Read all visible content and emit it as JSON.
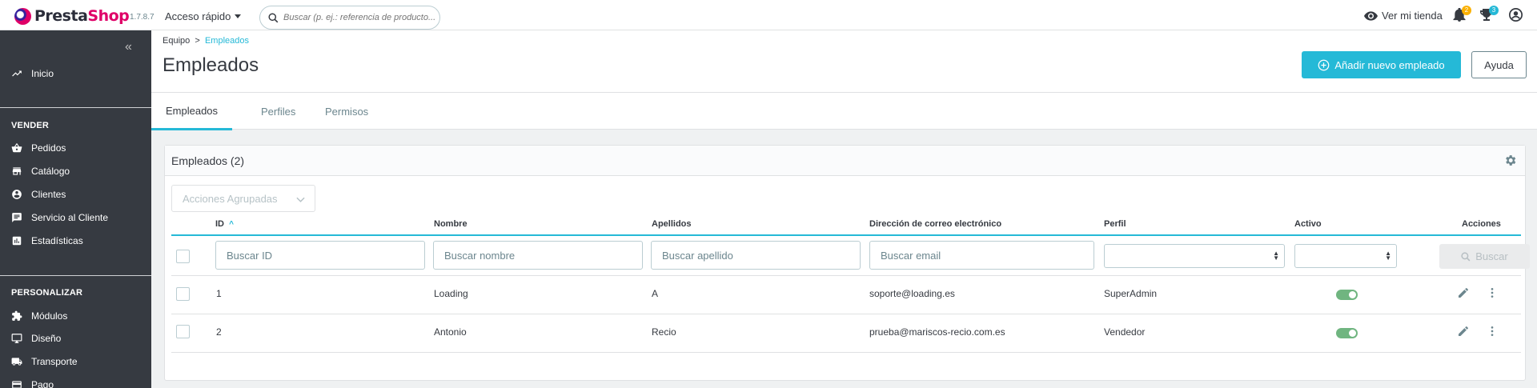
{
  "header": {
    "logo_part1": "Presta",
    "logo_part2": "Shop",
    "version": "1.7.8.7",
    "quick_access": "Acceso rápido",
    "search_placeholder": "Buscar (p. ej.: referencia de producto...",
    "view_store": "Ver mi tienda",
    "notifications_count": "2",
    "orders_count": "3"
  },
  "sidebar": {
    "home": "Inicio",
    "section_sell": "VENDER",
    "sell_items": [
      "Pedidos",
      "Catálogo",
      "Clientes",
      "Servicio al Cliente",
      "Estadísticas"
    ],
    "section_customize": "PERSONALIZAR",
    "customize_items": [
      "Módulos",
      "Diseño",
      "Transporte",
      "Pago"
    ]
  },
  "toolbar": {
    "breadcrumb_parent": "Equipo",
    "breadcrumb_sep": ">",
    "breadcrumb_current": "Empleados",
    "title": "Empleados",
    "add_button": "Añadir nuevo empleado",
    "help_button": "Ayuda"
  },
  "tabs": [
    "Empleados",
    "Perfiles",
    "Permisos"
  ],
  "card": {
    "title": "Empleados (2)",
    "bulk_actions": "Acciones Agrupadas"
  },
  "table": {
    "columns": [
      "ID",
      "Nombre",
      "Apellidos",
      "Dirección de correo electrónico",
      "Perfil",
      "Activo",
      "Acciones"
    ],
    "filters": {
      "id": "Buscar ID",
      "name": "Buscar nombre",
      "lastname": "Buscar apellido",
      "email": "Buscar email",
      "search_button": "Buscar"
    },
    "rows": [
      {
        "id": "1",
        "name": "Loading",
        "lastname": "A",
        "email": "soporte@loading.es",
        "profile": "SuperAdmin",
        "active": true
      },
      {
        "id": "2",
        "name": "Antonio",
        "lastname": "Recio",
        "email": "prueba@mariscos-recio.com.es",
        "profile": "Vendedor",
        "active": true
      }
    ]
  },
  "colors": {
    "accent": "#25b9d7",
    "sidebar_bg": "#363a41",
    "toggle_on": "#70b580",
    "brand_pink": "#df0067"
  }
}
